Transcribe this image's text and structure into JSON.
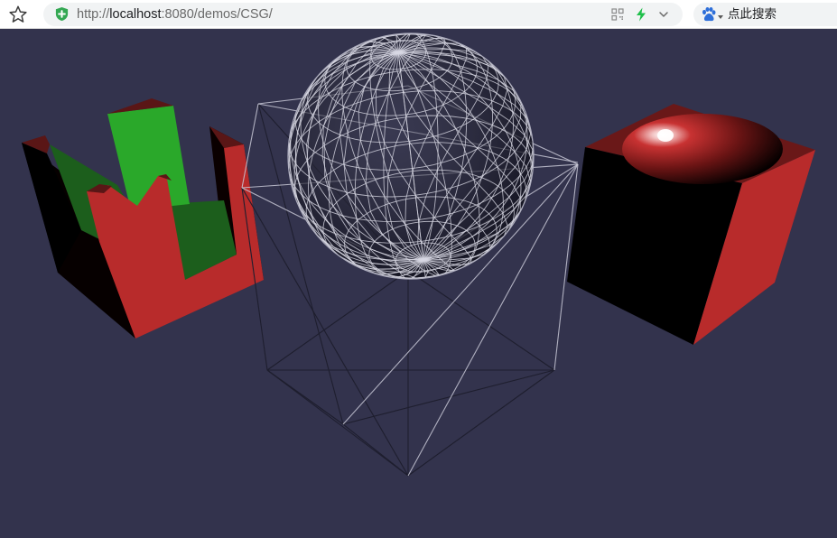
{
  "address_bar": {
    "url_scheme": "http://",
    "url_host": "localhost",
    "url_path": ":8080/demos/CSG/"
  },
  "search_engine": {
    "label": "点此搜索",
    "icon": "baidu-paw-icon"
  },
  "icons": {
    "bookmark": "star-outline-icon",
    "secure": "shield-plus-icon",
    "qr": "qr-code-icon",
    "speed": "lightning-bolt-icon",
    "dropdown": "chevron-down-icon"
  },
  "colors": {
    "viewport_background": "#33334d",
    "red": "#b82b2b",
    "dark_red": "#5a1616",
    "green": "#2aa82a",
    "dark_green": "#1c5e1c",
    "wire_light": "#d0d0dc",
    "wire_dark": "#1e1e2e",
    "address_bg": "#f1f3f4",
    "secure_green": "#34a853",
    "bolt_green": "#1fbf4a"
  }
}
